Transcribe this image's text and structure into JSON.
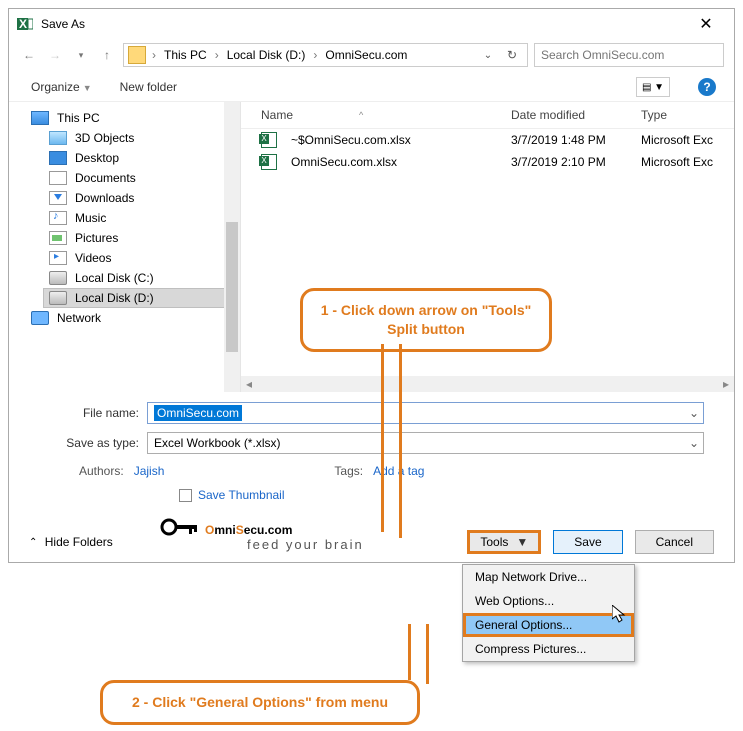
{
  "title": "Save As",
  "breadcrumb": {
    "root": "This PC",
    "drive": "Local Disk (D:)",
    "folder": "OmniSecu.com"
  },
  "search": {
    "placeholder": "Search OmniSecu.com"
  },
  "toolbar": {
    "organize": "Organize",
    "newfolder": "New folder"
  },
  "tree": [
    {
      "label": "This PC",
      "ico": "pc-ico"
    },
    {
      "label": "3D Objects",
      "ico": "cube-ico"
    },
    {
      "label": "Desktop",
      "ico": "desk-ico"
    },
    {
      "label": "Documents",
      "ico": "doc-ico"
    },
    {
      "label": "Downloads",
      "ico": "dl-ico"
    },
    {
      "label": "Music",
      "ico": "mus-ico"
    },
    {
      "label": "Pictures",
      "ico": "pic-ico"
    },
    {
      "label": "Videos",
      "ico": "vid-ico"
    },
    {
      "label": "Local Disk (C:)",
      "ico": "disk-ico"
    },
    {
      "label": "Local Disk (D:)",
      "ico": "disk-ico",
      "sel": true
    },
    {
      "label": "Network",
      "ico": "net-ico"
    }
  ],
  "columns": {
    "name": "Name",
    "date": "Date modified",
    "type": "Type"
  },
  "files": [
    {
      "name": "~$OmniSecu.com.xlsx",
      "date": "3/7/2019 1:48 PM",
      "type": "Microsoft Exc"
    },
    {
      "name": "OmniSecu.com.xlsx",
      "date": "3/7/2019 2:10 PM",
      "type": "Microsoft Exc"
    }
  ],
  "form": {
    "filename_label": "File name:",
    "filename_value": "OmniSecu.com",
    "type_label": "Save as type:",
    "type_value": "Excel Workbook (*.xlsx)",
    "authors_label": "Authors:",
    "authors_value": "Jajish",
    "tags_label": "Tags:",
    "tags_value": "Add a tag",
    "thumb": "Save Thumbnail"
  },
  "logo": {
    "text1": "O",
    "text2": "mni",
    "text3": "S",
    "text4": "ecu.com",
    "sub": "feed your brain"
  },
  "buttons": {
    "hide": "Hide Folders",
    "tools": "Tools",
    "save": "Save",
    "cancel": "Cancel"
  },
  "menu": [
    "Map Network Drive...",
    "Web Options...",
    "General Options...",
    "Compress Pictures..."
  ],
  "callouts": {
    "c1": "1 - Click down arrow on \"Tools\" Split button",
    "c2": "2 - Click \"General Options\" from menu"
  }
}
